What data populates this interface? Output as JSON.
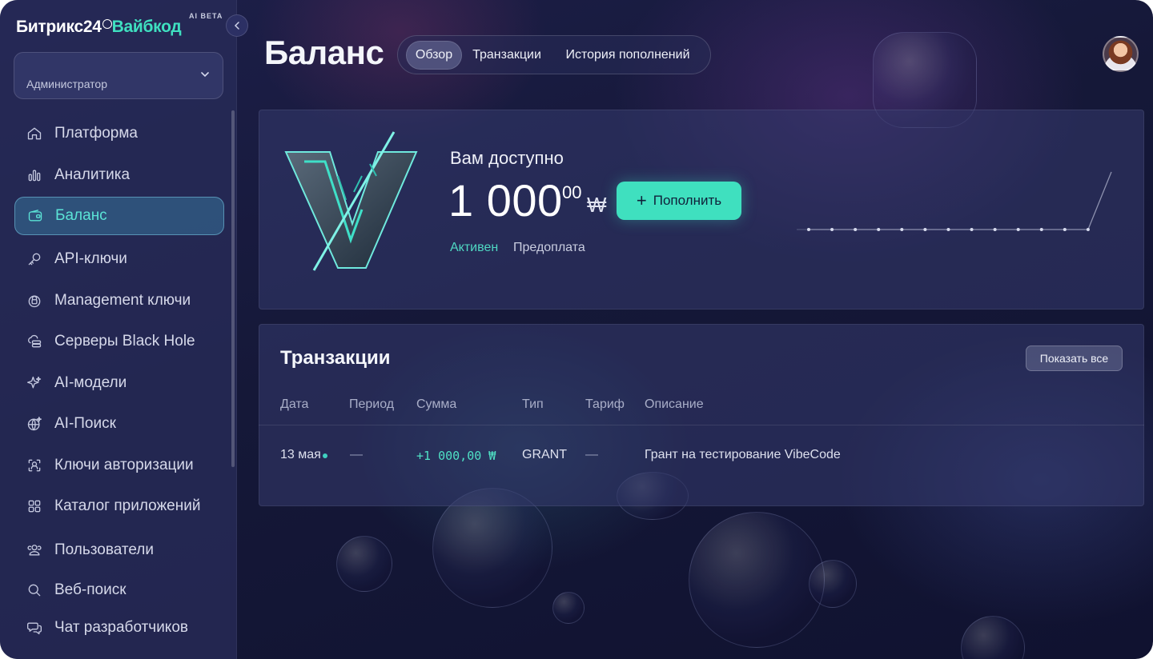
{
  "brand": {
    "name_part1": "Битрикс24",
    "name_part2": "Вайбкод",
    "badge": "AI BETA"
  },
  "role_select": {
    "value": "Администратор"
  },
  "sidebar": {
    "items": [
      {
        "label": "Платформа",
        "icon": "home-icon"
      },
      {
        "label": "Аналитика",
        "icon": "bar-chart-icon"
      },
      {
        "label": "Баланс",
        "icon": "wallet-icon",
        "active": true
      },
      {
        "label": "API-ключи",
        "icon": "key-icon"
      },
      {
        "label": "Management ключи",
        "icon": "lock-icon"
      },
      {
        "label": "Серверы Black Hole",
        "icon": "cloud-server-icon"
      },
      {
        "label": "AI-модели",
        "icon": "sparkle-icon"
      },
      {
        "label": "AI-Поиск",
        "icon": "globe-sparkle-icon"
      },
      {
        "label": "Ключи авторизации",
        "icon": "user-scan-icon"
      },
      {
        "label": "Каталог приложений",
        "icon": "grid-icon"
      },
      {
        "label": "Пользователи",
        "icon": "users-icon"
      },
      {
        "label": "Веб-поиск",
        "icon": "search-icon"
      },
      {
        "label": "Чат разработчиков",
        "icon": "chat-icon"
      }
    ]
  },
  "header": {
    "title": "Баланс",
    "tabs": [
      {
        "label": "Обзор",
        "active": true
      },
      {
        "label": "Транзакции"
      },
      {
        "label": "История пополнений"
      }
    ]
  },
  "balance": {
    "label": "Вам доступно",
    "amount": "1 000",
    "cents": "00",
    "currency": "₩",
    "topup_label": "Пополнить",
    "status": "Активен",
    "billing_type": "Предоплата",
    "sparkline": [
      0,
      0,
      0,
      0,
      0,
      0,
      0,
      0,
      0,
      0,
      0,
      0,
      0,
      1000
    ]
  },
  "transactions": {
    "title": "Транзакции",
    "show_all_label": "Показать все",
    "columns": [
      "Дата",
      "Период",
      "Сумма",
      "Тип",
      "Тариф",
      "Описание"
    ],
    "rows": [
      {
        "date": "13 мая",
        "period": "—",
        "amount": "+1 000,00 ₩",
        "type": "GRANT",
        "tariff": "—",
        "description": "Грант на тестирование VibeCode"
      }
    ]
  },
  "colors": {
    "accent": "#3fe0bf",
    "background": "#151838",
    "sidebar": "#282c58"
  }
}
